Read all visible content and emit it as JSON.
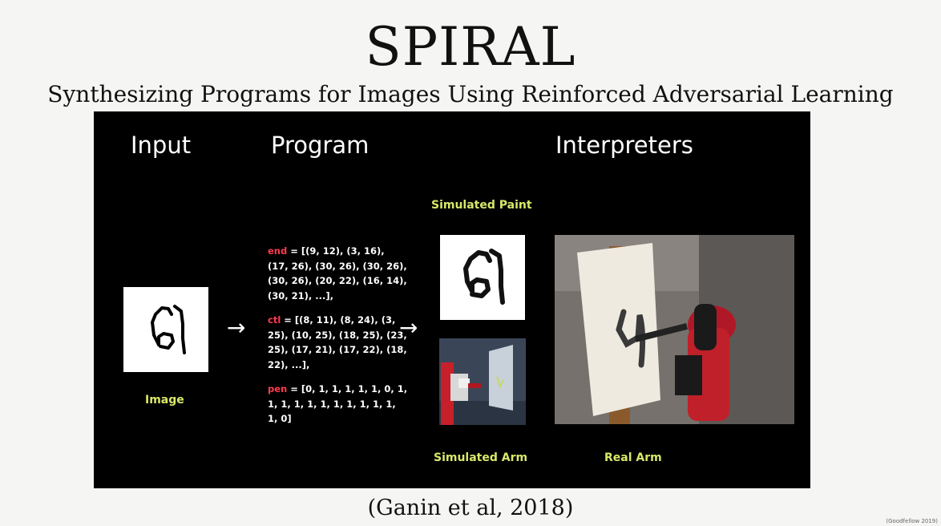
{
  "title": "SPIRAL",
  "subtitle": "Synthesizing Programs for Images Using Reinforced Adversarial Learning",
  "citation": "(Ganin et al, 2018)",
  "footnote": "(Goodfellow 2019)",
  "slide": {
    "headers": {
      "input": "Input",
      "program": "Program",
      "interpreters": "Interpreters"
    },
    "labels": {
      "image": "Image",
      "simulated_paint": "Simulated Paint",
      "simulated_arm": "Simulated Arm",
      "real_arm": "Real Arm"
    },
    "program": {
      "end_kw": "end",
      "end_val": " = [(9, 12), (3, 16), (17, 26), (30, 26), (30, 26), (30, 26), (20, 22), (16, 14), (30, 21), ...],",
      "ctl_kw": "ctl",
      "ctl_val": " = [(8, 11), (8, 24), (3, 25), (10, 25), (18, 25), (23, 25), (17, 21), (17, 22), (18, 22), ...],",
      "pen_kw": "pen",
      "pen_val": " = [0, 1, 1, 1, 1, 1, 0, 1, 1, 1, 1, 1, 1, 1, 1, 1, 1, 1, 1, 0]"
    },
    "arrow_glyph": "→",
    "colors": {
      "label": "#d8e86a",
      "keyword": "#ff3b4f",
      "background": "#000000"
    }
  }
}
